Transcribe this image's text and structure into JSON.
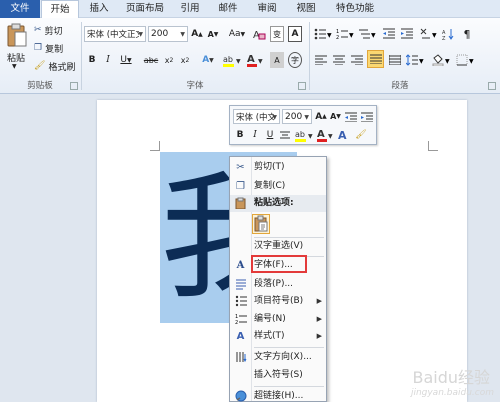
{
  "tabs": [
    {
      "label": "文件"
    },
    {
      "label": "开始"
    },
    {
      "label": "插入"
    },
    {
      "label": "页面布局"
    },
    {
      "label": "引用"
    },
    {
      "label": "邮件"
    },
    {
      "label": "审阅"
    },
    {
      "label": "视图"
    },
    {
      "label": "特色功能"
    }
  ],
  "clipboard": {
    "paste": "粘贴",
    "cut": "剪切",
    "copy": "复制",
    "format_painter": "格式刷",
    "group": "剪贴板"
  },
  "font": {
    "family": "宋体 (中文正文",
    "size": "200",
    "group": "字体"
  },
  "paragraph": {
    "group": "段落"
  },
  "mini_toolbar": {
    "family": "宋体 (中文",
    "size": "200"
  },
  "document": {
    "glyph": "我"
  },
  "context_menu": {
    "items": [
      {
        "label": "剪切(T)",
        "icon": "scissors-icon"
      },
      {
        "label": "复制(C)",
        "icon": "copy-icon"
      },
      {
        "label": "粘贴选项:",
        "icon": "paste-icon"
      },
      {
        "label": "汉字重选(V)",
        "icon": ""
      },
      {
        "label": "字体(F)...",
        "icon": "font-icon"
      },
      {
        "label": "段落(P)...",
        "icon": "paragraph-icon"
      },
      {
        "label": "项目符号(B)",
        "icon": "bullets-icon"
      },
      {
        "label": "编号(N)",
        "icon": "numbering-icon"
      },
      {
        "label": "样式(T)",
        "icon": "styles-icon"
      },
      {
        "label": "文字方向(X)...",
        "icon": "text-direction-icon"
      },
      {
        "label": "插入符号(S)",
        "icon": ""
      },
      {
        "label": "超链接(H)...",
        "icon": "hyperlink-icon"
      }
    ]
  },
  "watermark": {
    "text": "jingyan.baidu.com"
  },
  "colors": {
    "file_tab": "#2a5fad",
    "selection": "#a9cdee",
    "highlight_box": "#e33a3a",
    "glyph": "#0c2c55"
  }
}
